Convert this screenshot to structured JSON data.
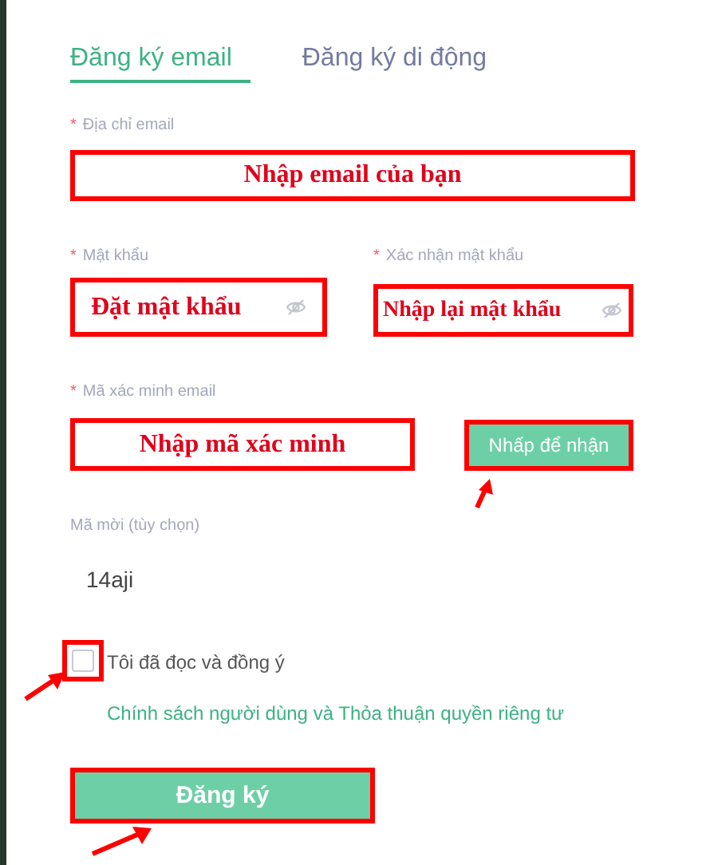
{
  "tabs": [
    {
      "label": "Đăng ký email",
      "selected": true
    },
    {
      "label": "Đăng ký di động",
      "selected": false
    }
  ],
  "email": {
    "mark": "*",
    "label": "Địa chỉ email",
    "annotation": "Nhập email của bạn"
  },
  "passwords": [
    {
      "mark": "*",
      "label": "Mật khẩu",
      "annotation": "Đặt mật khẩu"
    },
    {
      "mark": "*",
      "label": "Xác nhận mật khẩu",
      "annotation": "Nhập lại mật khẩu"
    }
  ],
  "verification": {
    "mark": "*",
    "label": "Mã xác minh email",
    "annotation": "Nhập mã xác minh",
    "button": "Nhấp để nhận"
  },
  "invite": {
    "label": "Mã mời (tùy chọn)",
    "value": "14aji"
  },
  "agreement": {
    "checked": false,
    "text": "Tôi đã đọc và đồng ý",
    "link": "Chính sách người dùng và Thỏa thuận quyền riêng tư"
  },
  "submit": "Đăng ký"
}
